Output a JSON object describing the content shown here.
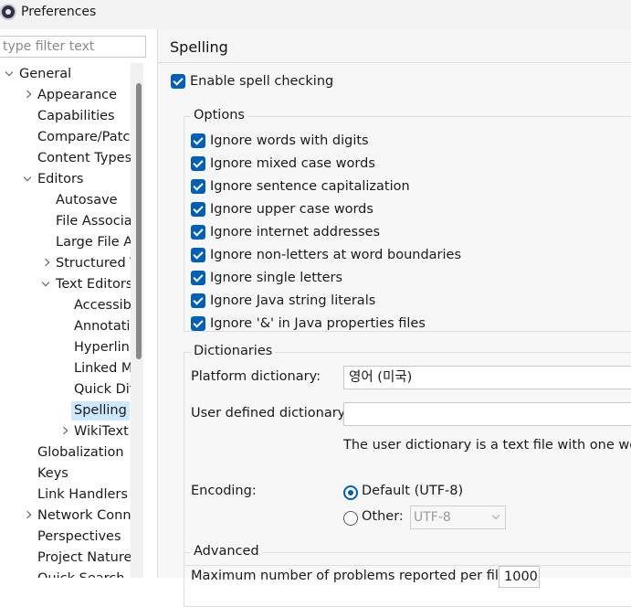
{
  "window": {
    "title": "Preferences"
  },
  "filter": {
    "placeholder": "type filter text"
  },
  "tree": [
    {
      "label": "General",
      "chevron": "down",
      "indent": 0
    },
    {
      "label": "Appearance",
      "chevron": "right",
      "indent": 1
    },
    {
      "label": "Capabilities",
      "chevron": "",
      "indent": 1
    },
    {
      "label": "Compare/Patch",
      "chevron": "",
      "indent": 1
    },
    {
      "label": "Content Types",
      "chevron": "",
      "indent": 1
    },
    {
      "label": "Editors",
      "chevron": "down",
      "indent": 1
    },
    {
      "label": "Autosave",
      "chevron": "",
      "indent": 2
    },
    {
      "label": "File Associations",
      "chevron": "",
      "indent": 2
    },
    {
      "label": "Large File Associations",
      "chevron": "",
      "indent": 2
    },
    {
      "label": "Structured Text",
      "chevron": "right",
      "indent": 2
    },
    {
      "label": "Text Editors",
      "chevron": "down",
      "indent": 2
    },
    {
      "label": "Accessibility",
      "chevron": "",
      "indent": 3
    },
    {
      "label": "Annotations",
      "chevron": "",
      "indent": 3
    },
    {
      "label": "Hyperlinking",
      "chevron": "",
      "indent": 3
    },
    {
      "label": "Linked Mode",
      "chevron": "",
      "indent": 3
    },
    {
      "label": "Quick Diff",
      "chevron": "",
      "indent": 3
    },
    {
      "label": "Spelling",
      "chevron": "",
      "indent": 3,
      "selected": true
    },
    {
      "label": "WikiText",
      "chevron": "right",
      "indent": 3
    },
    {
      "label": "Globalization",
      "chevron": "",
      "indent": 1
    },
    {
      "label": "Keys",
      "chevron": "",
      "indent": 1
    },
    {
      "label": "Link Handlers",
      "chevron": "",
      "indent": 1
    },
    {
      "label": "Network Connections",
      "chevron": "right",
      "indent": 1
    },
    {
      "label": "Perspectives",
      "chevron": "",
      "indent": 1
    },
    {
      "label": "Project Natures",
      "chevron": "",
      "indent": 1
    },
    {
      "label": "Quick Search",
      "chevron": "",
      "indent": 1
    }
  ],
  "page": {
    "title": "Spelling",
    "enable_label": "Enable spell checking",
    "options_title": "Options",
    "options": [
      "Ignore words with digits",
      "Ignore mixed case words",
      "Ignore sentence capitalization",
      "Ignore upper case words",
      "Ignore internet addresses",
      "Ignore non-letters at word boundaries",
      "Ignore single letters",
      "Ignore Java string literals",
      "Ignore '&' in Java properties files"
    ],
    "dictionaries_title": "Dictionaries",
    "platform_dict_label": "Platform dictionary:",
    "platform_dict_value": "영어 (미국)",
    "user_dict_label": "User defined dictionary:",
    "user_dict_value": "",
    "user_dict_note": "The user dictionary is a text file with one word",
    "encoding_label": "Encoding:",
    "encoding_default": "Default (UTF-8)",
    "encoding_other": "Other:",
    "encoding_other_value": "UTF-8",
    "advanced_title": "Advanced",
    "max_problems_label": "Maximum number of problems reported per file:",
    "max_problems_value": "1000"
  },
  "colors": {
    "accent": "#005fb8",
    "selection": "#cde8ff"
  }
}
